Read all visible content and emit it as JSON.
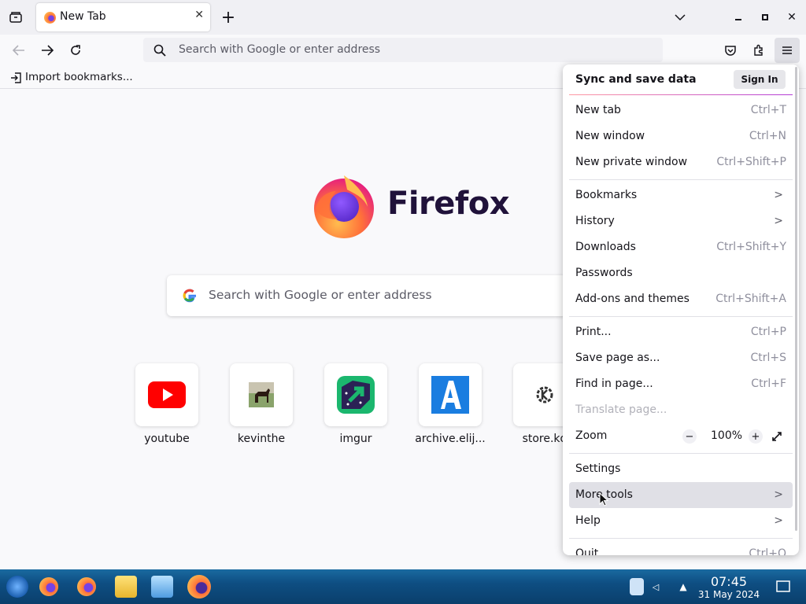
{
  "tabs": [
    {
      "title": "New Tab"
    }
  ],
  "toolbar": {
    "url_placeholder": "Search with Google or enter address"
  },
  "bookmarks_toolbar": {
    "import_label": "Import bookmarks..."
  },
  "newtab": {
    "brand": "Firefox",
    "search_placeholder": "Search with Google or enter address",
    "top_sites": [
      {
        "name": "youtube",
        "icon": "youtube-icon"
      },
      {
        "name": "kevinthe",
        "icon": "horse-thumbnail"
      },
      {
        "name": "imgur",
        "icon": "imgur-icon"
      },
      {
        "name": "archive.elij...",
        "icon": "archive-icon"
      },
      {
        "name": "store.kd",
        "icon": "kde-icon"
      }
    ]
  },
  "menu": {
    "header": "Sync and save data",
    "sign_in": "Sign In",
    "new_tab": {
      "label": "New tab",
      "shortcut": "Ctrl+T"
    },
    "new_window": {
      "label": "New window",
      "shortcut": "Ctrl+N"
    },
    "new_private": {
      "label": "New private window",
      "shortcut": "Ctrl+Shift+P"
    },
    "bookmarks": {
      "label": "Bookmarks"
    },
    "history": {
      "label": "History"
    },
    "downloads": {
      "label": "Downloads",
      "shortcut": "Ctrl+Shift+Y"
    },
    "passwords": {
      "label": "Passwords"
    },
    "addons": {
      "label": "Add-ons and themes",
      "shortcut": "Ctrl+Shift+A"
    },
    "print": {
      "label": "Print...",
      "shortcut": "Ctrl+P"
    },
    "save_page": {
      "label": "Save page as...",
      "shortcut": "Ctrl+S"
    },
    "find": {
      "label": "Find in page...",
      "shortcut": "Ctrl+F"
    },
    "translate": {
      "label": "Translate page..."
    },
    "zoom": {
      "label": "Zoom",
      "level": "100%"
    },
    "settings": {
      "label": "Settings"
    },
    "more_tools": {
      "label": "More tools"
    },
    "help": {
      "label": "Help"
    },
    "quit": {
      "label": "Quit",
      "shortcut": "Ctrl+Q"
    }
  },
  "taskbar": {
    "time": "07:45",
    "date": "31 May 2024"
  },
  "colors": {
    "accent": "#0060df",
    "taskbar": "#0e4e82",
    "menu_bg": "#ffffff"
  }
}
